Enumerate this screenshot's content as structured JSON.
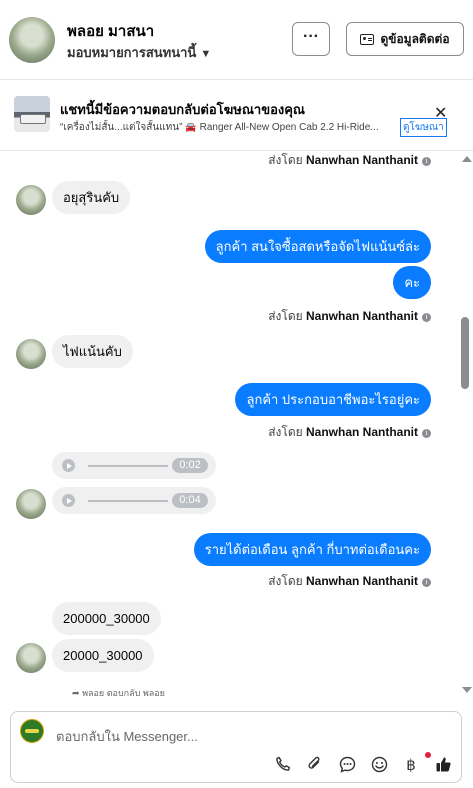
{
  "header": {
    "name": "พลอย มาสนา",
    "assignment": "มอบหมายการสนทนานี้",
    "more_label": "···",
    "contact_label": "ดูข้อมูลติดต่อ"
  },
  "banner": {
    "title": "แชทนี้มีข้อความตอบกลับต่อโฆษณาของคุณ",
    "quote": "“เครื่องไม่สั้น...แต่ใจสั้นแทน”",
    "product": "Ranger All-New Open Cab 2.2 Hi-Ride...",
    "view_ad": "ดูโฆษณา",
    "close": "✕"
  },
  "messages": {
    "sent_by_prefix": "ส่งโดย",
    "agent_name": "Nanwhan Nanthanit",
    "m1": "อยุสุรินคับ",
    "m2": "ลูกค้า สนใจซื้อสดหรือจัดไฟแน้นซ์ล่ะ",
    "m3": "คะ",
    "m4": "ไฟแน้นคับ",
    "m5": "ลูกค้า ประกอบอาชีพอะไรอยู่คะ",
    "audio1": "0:02",
    "audio2": "0:04",
    "m6": "รายได้ต่อเดือน ลูกค้า กี่บาทต่อเดือนคะ",
    "m7": "200000_30000",
    "m8": "20000_30000",
    "reply_note": "พลอย ตอบกลับ พลอย"
  },
  "composer": {
    "placeholder": "ตอบกลับใน Messenger..."
  },
  "icons": {
    "phone": "phone-icon",
    "attach": "paperclip-icon",
    "saved": "saved-reply-icon",
    "emoji": "emoji-icon",
    "baht": "baht-icon",
    "like": "thumbs-up-icon"
  },
  "colors": {
    "outgoing_bubble": "#0a7cff",
    "incoming_bubble": "#f0f0f0",
    "link": "#1877f2"
  }
}
